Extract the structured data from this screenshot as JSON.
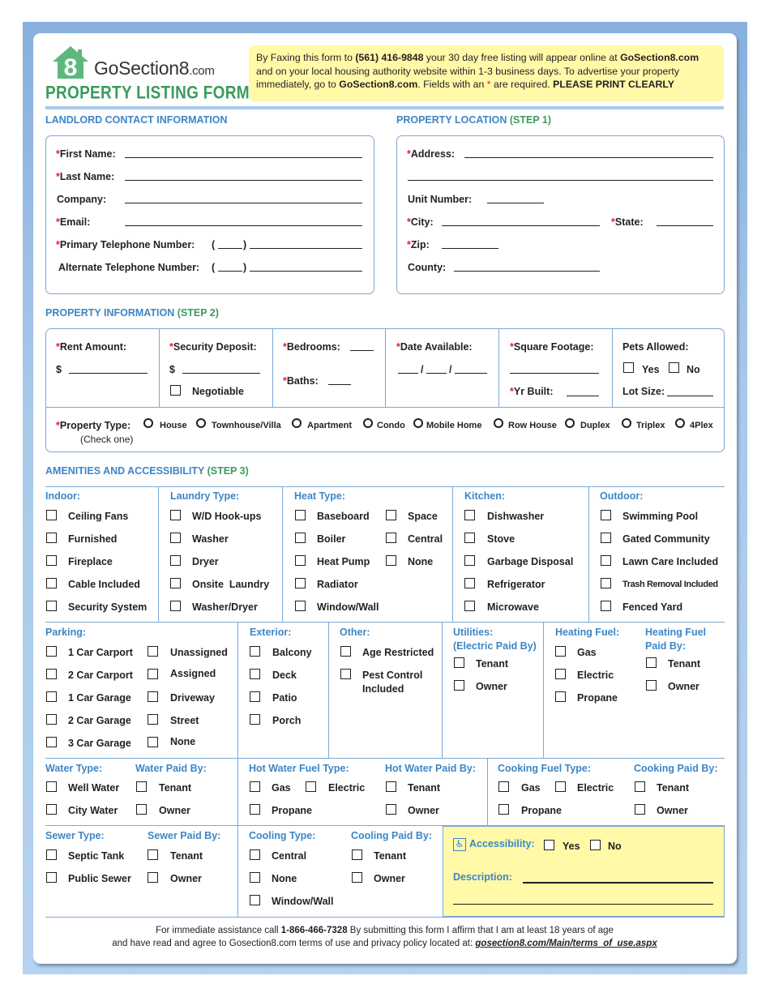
{
  "header": {
    "logo_brand": "GoSection8",
    "logo_suffix": ".com",
    "logo_icon": "house-8-icon",
    "form_title": "PROPERTY LISTING FORM",
    "notice": {
      "t1": "By Faxing this form to ",
      "fax": "(561) 416-9848",
      "t2": " your 30 day free listing will appear online at ",
      "site1": "GoSection8.com",
      "t3": " and on your local housing authority website within 1-3 business days. To advertise your property immediately, go to ",
      "site2": "GoSection8.com",
      "t4": ". Fields with an ",
      "star": "*",
      "t5": " are required. ",
      "print": "PLEASE PRINT CLEARLY"
    }
  },
  "landlord": {
    "title": "LANDLORD CONTACT INFORMATION",
    "first_name": "First Name:",
    "last_name": "Last Name:",
    "company": "Company:",
    "email": "Email:",
    "primary_phone": "Primary Telephone Number:",
    "alt_phone": "Alternate Telephone Number:",
    "paren_open": "(",
    "paren_close": ")",
    "required_mark": "*"
  },
  "location": {
    "title": "PROPERTY LOCATION",
    "step": "(STEP 1)",
    "address": "Address:",
    "unit": "Unit Number:",
    "city": "City:",
    "state": "State:",
    "zip": "Zip:",
    "county": "County:"
  },
  "property": {
    "title": "PROPERTY INFORMATION",
    "step": "(STEP 2)",
    "rent": "Rent Amount:",
    "dollar": "$",
    "deposit": "Security Deposit:",
    "negotiable": "Negotiable",
    "bedrooms": "Bedrooms:",
    "baths": "Baths:",
    "date": "Date Available:",
    "slash": "/",
    "sqft": "Square Footage:",
    "yr_built": "Yr Built:",
    "pets": "Pets Allowed:",
    "yes": "Yes",
    "no": "No",
    "lot": "Lot Size:",
    "type_label": "Property Type:",
    "type_hint": "(Check one)",
    "types": [
      "House",
      "Townhouse/Villa",
      "Apartment",
      "Condo",
      "Mobile Home",
      "Row House",
      "Duplex",
      "Triplex",
      "4Plex"
    ]
  },
  "amenities": {
    "title": "AMENITIES AND ACCESSIBILITY",
    "step": "(STEP 3)",
    "indoor": {
      "head": "Indoor:",
      "items": [
        "Ceiling Fans",
        "Furnished",
        "Fireplace",
        "Cable Included",
        "Security System"
      ]
    },
    "laundry": {
      "head": "Laundry Type:",
      "items": [
        "W/D Hook-ups",
        "Washer",
        "Dryer",
        "Onsite  Laundry",
        "Washer/Dryer"
      ]
    },
    "heat": {
      "head": "Heat Type:",
      "items": [
        "Baseboard",
        "Boiler",
        "Heat Pump",
        "Radiator",
        "Window/Wall",
        "Space",
        "Central",
        "None"
      ]
    },
    "kitchen": {
      "head": "Kitchen:",
      "items": [
        "Dishwasher",
        "Stove",
        "Garbage Disposal",
        "Refrigerator",
        "Microwave"
      ]
    },
    "outdoor": {
      "head": "Outdoor:",
      "items": [
        "Swimming Pool",
        "Gated Community",
        "Lawn Care Included",
        "Trash Removal Included",
        "Fenced Yard"
      ]
    },
    "parking": {
      "head": "Parking:",
      "items": [
        "1 Car Carport",
        "2 Car Carport",
        "1 Car Garage",
        "2 Car Garage",
        "3 Car Garage",
        "Unassigned",
        "Assigned",
        "Driveway",
        "Street",
        "None"
      ]
    },
    "exterior": {
      "head": "Exterior:",
      "items": [
        "Balcony",
        "Deck",
        "Patio",
        "Porch"
      ]
    },
    "other": {
      "head": "Other:",
      "items": [
        "Age Restricted",
        "Pest Control",
        "Included"
      ]
    },
    "utilities": {
      "head1": "Utilities:",
      "head2": "(Electric Paid By)",
      "items": [
        "Tenant",
        "Owner"
      ]
    },
    "heating_fuel": {
      "head": "Heating Fuel:",
      "items": [
        "Gas",
        "Electric",
        "Propane"
      ]
    },
    "heating_paid": {
      "head1": "Heating Fuel",
      "head2": "Paid By:",
      "items": [
        "Tenant",
        "Owner"
      ]
    },
    "water_type": {
      "head": "Water Type:",
      "items": [
        "Well Water",
        "City Water"
      ]
    },
    "water_paid": {
      "head": "Water Paid By:",
      "items": [
        "Tenant",
        "Owner"
      ]
    },
    "hot_water_fuel": {
      "head": "Hot Water Fuel Type:",
      "items": [
        "Gas",
        "Electric",
        "Propane"
      ]
    },
    "hot_water_paid": {
      "head": "Hot Water Paid By:",
      "items": [
        "Tenant",
        "Owner"
      ]
    },
    "cooking_fuel": {
      "head": "Cooking Fuel Type:",
      "items": [
        "Gas",
        "Electric",
        "Propane"
      ]
    },
    "cooking_paid": {
      "head": "Cooking Paid By:",
      "items": [
        "Tenant",
        "Owner"
      ]
    },
    "sewer_type": {
      "head": "Sewer Type:",
      "items": [
        "Septic Tank",
        "Public Sewer"
      ]
    },
    "sewer_paid": {
      "head": "Sewer Paid By:",
      "items": [
        "Tenant",
        "Owner"
      ]
    },
    "cooling_type": {
      "head": "Cooling Type:",
      "items": [
        "Central",
        "None",
        "Window/Wall"
      ]
    },
    "cooling_paid": {
      "head": "Cooling Paid By:",
      "items": [
        "Tenant",
        "Owner"
      ]
    },
    "accessibility": {
      "label": "Accessibility:",
      "yes": "Yes",
      "no": "No",
      "description": "Description:",
      "icon": "wheelchair-icon"
    }
  },
  "footer": {
    "t1": "For immediate assistance call ",
    "phone": "1-866-466-7328",
    "t2": " By submitting this form I affirm that I am at least 18 years of age",
    "t3": "and have read and agree to Gosection8.com terms of use and privacy policy located at: ",
    "link": "gosection8.com/Main/terms_of_use.aspx"
  },
  "colors": {
    "brand_green": "#3a9c5c",
    "section_blue": "#3d86c6",
    "border_blue": "#7ca8d8",
    "notice_yellow": "#fff9a8",
    "required_red": "#ed1c24"
  }
}
